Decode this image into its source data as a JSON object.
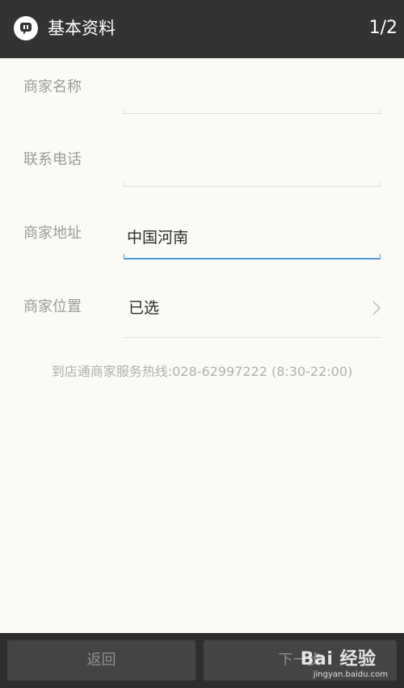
{
  "header": {
    "title": "基本资料",
    "page_indicator": "1/2",
    "icon": "chat-bubble-icon"
  },
  "form": {
    "merchant_name": {
      "label": "商家名称",
      "value": ""
    },
    "contact_phone": {
      "label": "联系电话",
      "value": ""
    },
    "merchant_address": {
      "label": "商家地址",
      "value": "中国河南"
    },
    "merchant_location": {
      "label": "商家位置",
      "value": "已选",
      "icon": "chevron-right-icon"
    }
  },
  "hotline": "到店通商家服务热线:028-62997222 (8:30-22:00)",
  "footer": {
    "back_label": "返回",
    "next_label": "下一步"
  },
  "watermark": {
    "brand": "Bai 经验",
    "url": "jingyan.baidu.com"
  },
  "colors": {
    "topbar": "#333333",
    "background": "#fbfaf6",
    "focus_underline": "#4f9bd9",
    "label": "#9b9b95",
    "bottom_bar": "#2e2e2e",
    "button": "#444444"
  }
}
